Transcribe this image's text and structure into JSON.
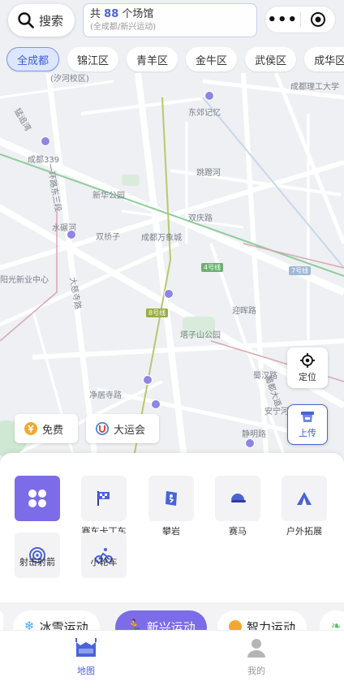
{
  "header": {
    "search_label": "搜索",
    "count_prefix": "共",
    "count_value": "88",
    "count_suffix": "个场馆",
    "count_sub": "(全成都/新兴运动)"
  },
  "districts": [
    "全成都",
    "锦江区",
    "青羊区",
    "金牛区",
    "武侯区",
    "成华区"
  ],
  "map": {
    "labels": [
      "(汐河校区)",
      "东郊记忆",
      "成都理工大学",
      "成都339",
      "新华公园",
      "跳蹬河",
      "双庆路",
      "水碾河",
      "双桥子",
      "成都万象城",
      "阳光新业中心",
      "迎晖路",
      "塔子山公园",
      "净居寺路",
      "蜀汉路",
      "安宁河",
      "静明路",
      "一环路东三段",
      "猛追湾",
      "大慈寺路",
      "蜀都大道"
    ],
    "badges": [
      "4号线",
      "7号线",
      "8号线"
    ]
  },
  "float": {
    "locate_label": "定位",
    "upload_label": "上传",
    "free_label": "免费",
    "games_label": "大运会"
  },
  "tiles": [
    "赛车卡丁车",
    "攀岩",
    "赛马",
    "户外拓展",
    "射击射箭",
    "小轮车"
  ],
  "categories": [
    "冰雪运动",
    "新兴运动",
    "智力运动"
  ],
  "tabbar": {
    "map_label": "地图",
    "mine_label": "我的"
  },
  "colors": {
    "accent": "#7c6ce8",
    "brand_blue": "#3d5bd9",
    "pin": "#8d86e6"
  }
}
